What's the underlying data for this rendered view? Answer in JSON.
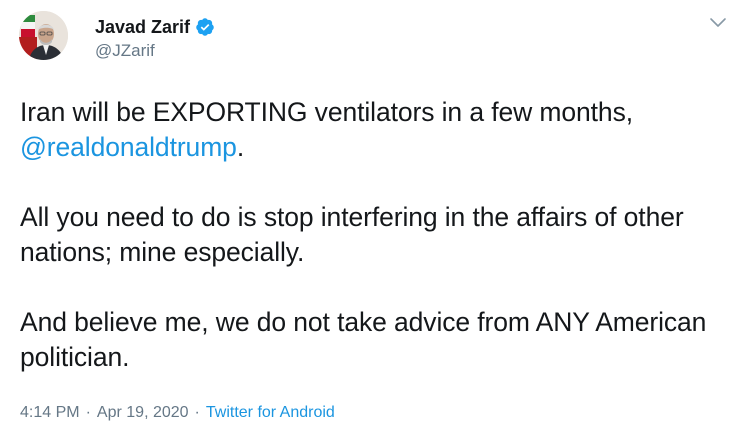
{
  "author": {
    "display_name": "Javad Zarif",
    "handle": "@JZarif",
    "verified": true
  },
  "tweet": {
    "line1_text": "Iran will be EXPORTING ventilators in a few months,",
    "mention": "@realdonaldtrump",
    "mention_suffix": ".",
    "para2": "All you need to do is stop interfering in the affairs of other nations; mine especially.",
    "para3": "And believe me, we do not take advice from ANY American politician."
  },
  "meta": {
    "time": "4:14 PM",
    "separator": "·",
    "date": "Apr 19, 2020",
    "source": "Twitter for Android"
  },
  "colors": {
    "link": "#1b95e0",
    "secondary_text": "#657786",
    "verified_badge": "#1da1f2"
  },
  "icons": {
    "verified": "verified-badge-icon",
    "menu": "chevron-down-icon"
  }
}
